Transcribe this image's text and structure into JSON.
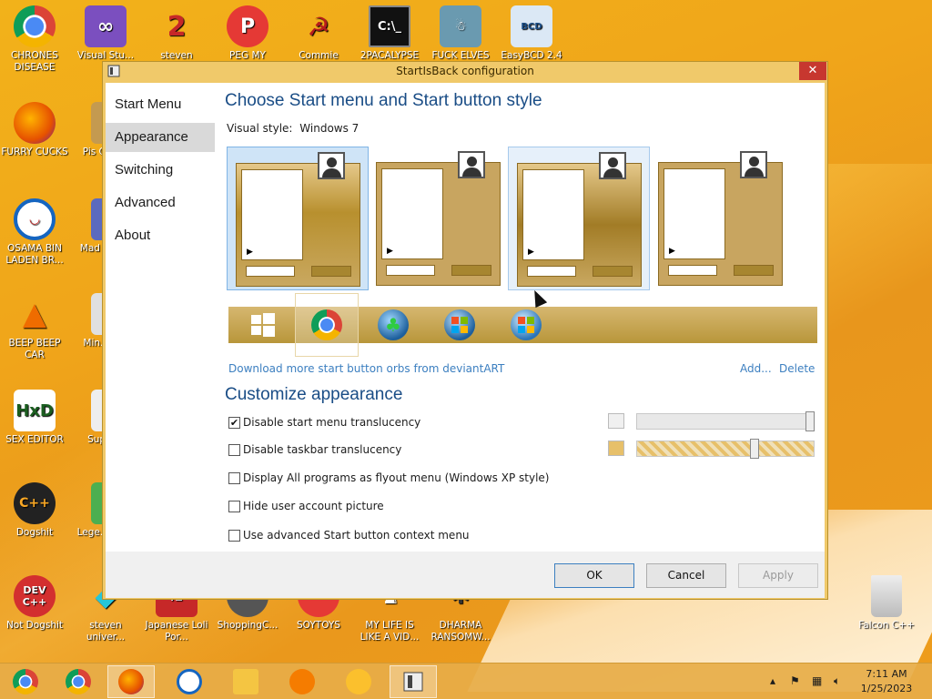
{
  "desktop": {
    "icons": [
      {
        "label": "CHRONES DISEASE",
        "icon": "chrome-icon"
      },
      {
        "label": "Visual Stu...",
        "icon": "visual-studio-icon"
      },
      {
        "label": "steven",
        "icon": "steven-icon"
      },
      {
        "label": "PEG MY WHEEL",
        "icon": "peg-icon"
      },
      {
        "label": "Commie",
        "icon": "commie-icon"
      },
      {
        "label": "2PACALYPSE",
        "icon": "cmd-icon"
      },
      {
        "label": "FUCK ELVES",
        "icon": "elf-icon"
      },
      {
        "label": "EasyBCD 2.4",
        "icon": "easybcd-icon"
      },
      {
        "label": "FURRY CUCKS",
        "icon": "firefox-icon"
      },
      {
        "label": "Pis Chic...",
        "icon": "pischic-icon"
      },
      {
        "label": "OSAMA BIN LADEN BR...",
        "icon": "obama-icon"
      },
      {
        "label": "Mad IN S...",
        "icon": "mad-icon"
      },
      {
        "label": "BEEP BEEP CAR",
        "icon": "vlc-icon"
      },
      {
        "label": "Min... B...",
        "icon": "min-icon"
      },
      {
        "label": "SEX EDITOR",
        "icon": "hxd-icon"
      },
      {
        "label": "Super...",
        "icon": "super-icon"
      },
      {
        "label": "Dogshit",
        "icon": "dogshit-icon"
      },
      {
        "label": "Lege... CR...",
        "icon": "legend-icon"
      },
      {
        "label": "Not Dogshit",
        "icon": "dev-cpp-icon"
      },
      {
        "label": "steven univer...",
        "icon": "gem-icon"
      },
      {
        "label": "Japanese Loli Por...",
        "icon": "japanese-icon"
      },
      {
        "label": "ShoppingC...",
        "icon": "shopping-icon"
      },
      {
        "label": "SOYTOYS",
        "icon": "soytoys-icon"
      },
      {
        "label": "MY LIFE IS LIKE A VID...",
        "icon": "mylife-icon"
      },
      {
        "label": "DHARMA RANSOMW...",
        "icon": "dharma-icon"
      },
      {
        "label": "Falcon C++",
        "icon": "recycle-bin-icon"
      }
    ]
  },
  "window": {
    "title": "StartIsBack configuration",
    "close_label": "✕",
    "nav": [
      "Start Menu",
      "Appearance",
      "Switching",
      "Advanced",
      "About"
    ],
    "active_nav": "Appearance",
    "heading_style": "Choose Start menu and Start button style",
    "visual_style_label": "Visual style:",
    "visual_style_value": "Windows 7",
    "download_link": "Download more start button orbs from deviantART",
    "add_link": "Add...",
    "delete_link": "Delete",
    "heading_customize": "Customize appearance",
    "options": [
      {
        "label": "Disable start menu translucency",
        "checked": true
      },
      {
        "label": "Disable taskbar translucency",
        "checked": false
      },
      {
        "label": "Display All programs as flyout menu (Windows XP style)",
        "checked": false
      },
      {
        "label": "Hide user account picture",
        "checked": false
      },
      {
        "label": "Use advanced Start button context menu",
        "checked": false
      }
    ],
    "sliders": [
      {
        "swatch": "#f0f0f0",
        "value": 1.0
      },
      {
        "swatch": "#e7c06a",
        "value": 0.66
      }
    ],
    "buttons": {
      "ok": "OK",
      "cancel": "Cancel",
      "apply": "Apply"
    }
  },
  "taskbar": {
    "time": "7:11 AM",
    "date": "1/25/2023"
  },
  "colors": {
    "accent": "#1a4d86",
    "link": "#3c7fc0",
    "gold": "#e7c06a"
  }
}
